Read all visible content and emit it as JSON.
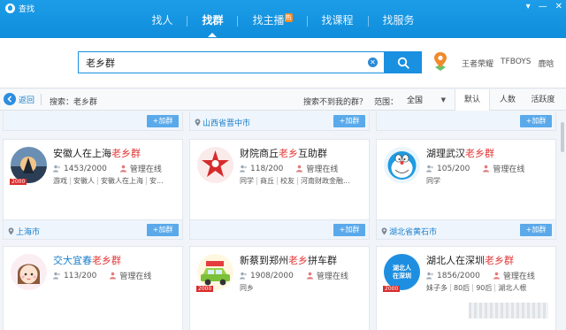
{
  "window": {
    "title": "查找",
    "controls": [
      "▾",
      "—",
      "✕"
    ]
  },
  "tabs": [
    {
      "label": "找人"
    },
    {
      "label": "找群",
      "active": true
    },
    {
      "label": "找主播",
      "badge": "热"
    },
    {
      "label": "找课程"
    },
    {
      "label": "找服务"
    }
  ],
  "search": {
    "value": "老乡群",
    "hot_words": [
      "王者荣耀",
      "TFBOYS",
      "鹿晗"
    ]
  },
  "filter": {
    "back_label": "返回",
    "crumb": "搜索：老乡群",
    "nofind": "搜索不到我的群？",
    "range_label": "范围：",
    "range_value": "全国",
    "sort_tabs": [
      {
        "label": "默认",
        "active": true
      },
      {
        "label": "人数"
      },
      {
        "label": "活跃度"
      }
    ]
  },
  "join_label": "+加群",
  "top_strip": {
    "location": "山西省晋中市"
  },
  "colors": {
    "accent": "#1a90e0",
    "highlight": "#e23636",
    "join": "#5aa9ea"
  },
  "cards": [
    {
      "name_pre": "安徽人在上海",
      "name_hl": "老乡群",
      "name_post": "",
      "members": "1453/2000",
      "admin": "管理在线",
      "tags": [
        "游戏",
        "安徽人",
        "安徽人在上海",
        "安..."
      ],
      "location": "上海市",
      "level": "2000",
      "avatar": "sunset-icon"
    },
    {
      "name_pre": "财院商丘",
      "name_hl": "老乡",
      "name_post": "互助群",
      "members": "118/200",
      "admin": "管理在线",
      "tags": [
        "同学",
        "商丘",
        "校友",
        "河南财政金融..."
      ],
      "location": "",
      "level": "",
      "avatar": "red-star-icon"
    },
    {
      "name_pre": "湖理武汉",
      "name_hl": "老乡群",
      "name_post": "",
      "members": "105/200",
      "admin": "管理在线",
      "tags": [
        "同学"
      ],
      "location": "湖北省黄石市",
      "level": "",
      "avatar": "doraemon-icon"
    },
    {
      "name_pre": "交大宜春",
      "name_hl": "老乡群",
      "name_post": "",
      "members": "113/200",
      "admin": "管理在线",
      "tags": [],
      "location": "",
      "level": "",
      "avatar": "cartoon-girl-icon",
      "blue": true
    },
    {
      "name_pre": "新蔡到郑州",
      "name_hl": "老乡",
      "name_post": "拼车群",
      "members": "1908/2000",
      "admin": "管理在线",
      "tags": [
        "同乡"
      ],
      "location": "",
      "level": "2000",
      "avatar": "car-icon"
    },
    {
      "name_pre": "湖北人在深圳",
      "name_hl": "老乡群",
      "name_post": "",
      "members": "1856/2000",
      "admin": "管理在线",
      "tags": [
        "妹子多",
        "80后",
        "90后",
        "湖北人根"
      ],
      "location": "",
      "level": "2000",
      "avatar": "hubei-text-icon",
      "avatar_text": "湖北人 在深圳"
    }
  ]
}
